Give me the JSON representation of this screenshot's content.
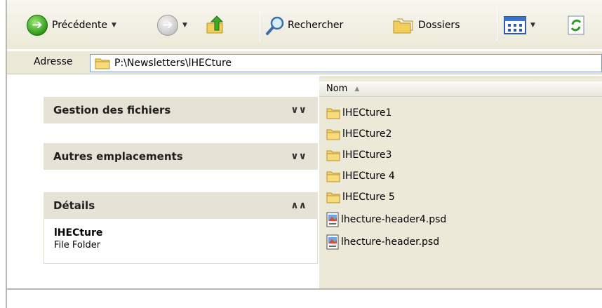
{
  "toolbar": {
    "back_label": "Précédente",
    "search_label": "Rechercher",
    "folders_label": "Dossiers"
  },
  "address": {
    "label": "Adresse",
    "path": "P:\\Newsletters\\lHECture"
  },
  "taskpane": {
    "panels": [
      {
        "title": "Gestion des fichiers",
        "state": "collapsed",
        "chevron": "»"
      },
      {
        "title": "Autres emplacements",
        "state": "collapsed",
        "chevron": "»"
      },
      {
        "title": "Détails",
        "state": "expanded",
        "chevron": "«"
      }
    ],
    "details": {
      "name": "lHECture",
      "type": "File Folder"
    }
  },
  "filelist": {
    "column_header": "Nom",
    "items": [
      {
        "name": "lHECture1",
        "icon": "folder-icon"
      },
      {
        "name": "lHECture2",
        "icon": "folder-icon"
      },
      {
        "name": "lHECture3",
        "icon": "folder-icon"
      },
      {
        "name": "lHECture 4",
        "icon": "folder-icon"
      },
      {
        "name": "lHECture 5",
        "icon": "folder-icon"
      },
      {
        "name": "lhecture-header4.psd",
        "icon": "psd-file-icon"
      },
      {
        "name": "lhecture-header.psd",
        "icon": "psd-file-icon"
      }
    ]
  },
  "colors": {
    "toolbar_bg": "#ece9d8",
    "panel_header_bg": "#e6e3d6",
    "back_button": "#2f9a16",
    "folder": "#f3d36b"
  }
}
